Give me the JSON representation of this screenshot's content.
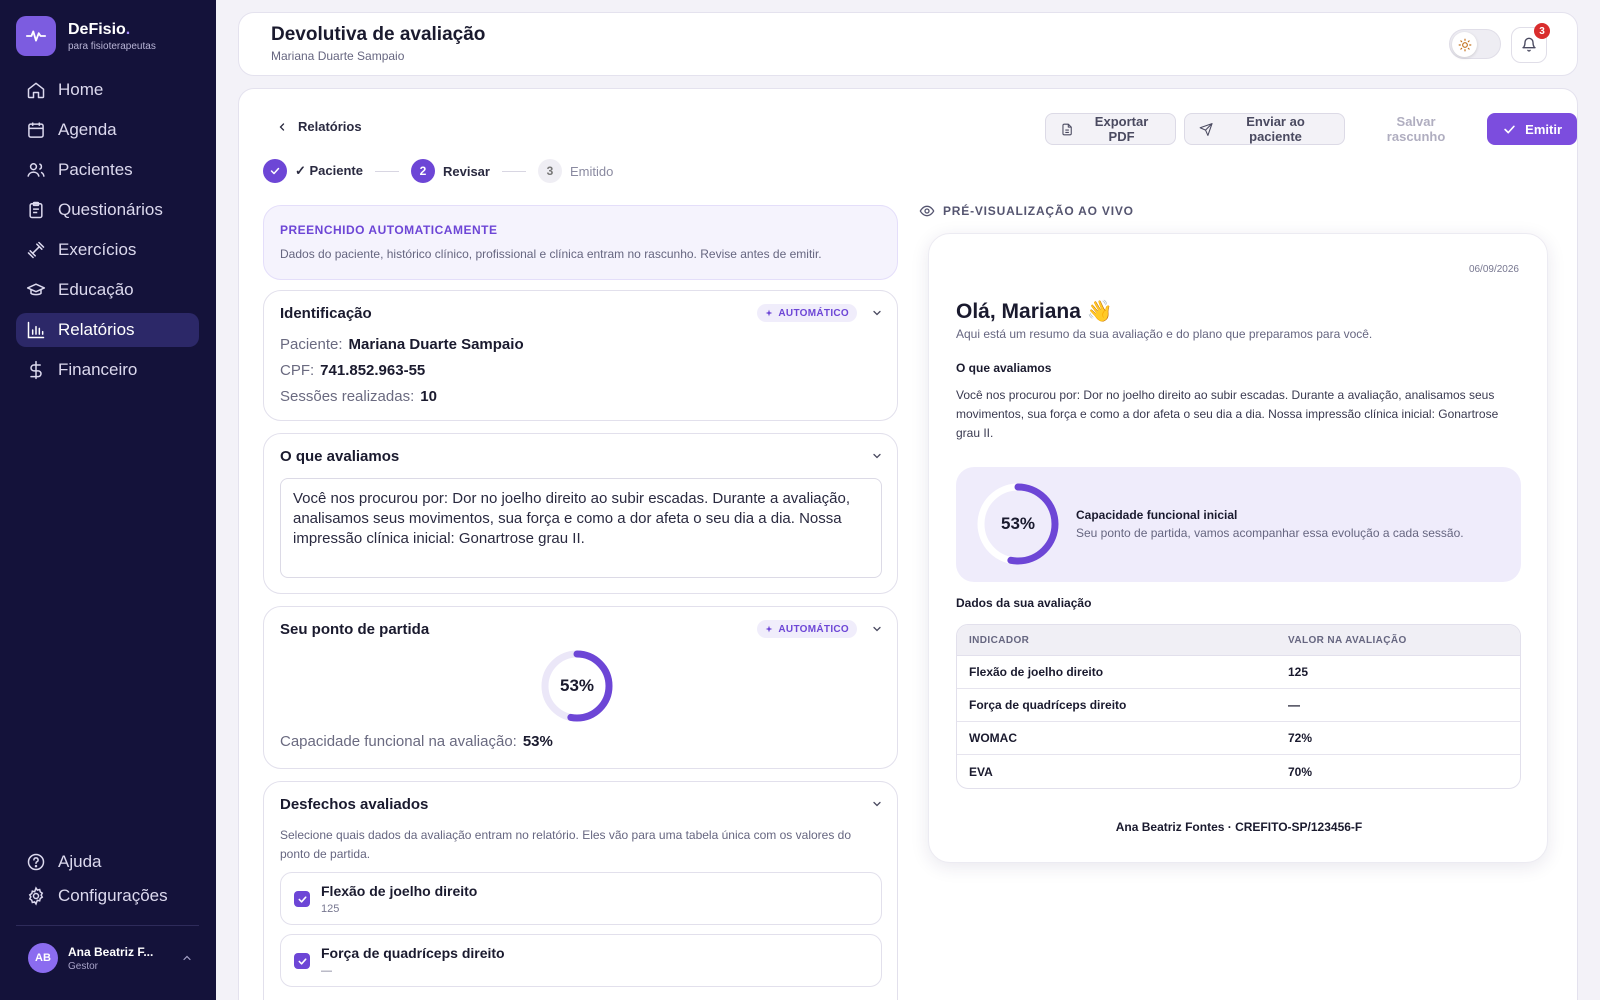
{
  "brand": {
    "name": "DeFisio",
    "dot": ".",
    "tagline": "para fisioterapeutas"
  },
  "nav": [
    {
      "label": "Home",
      "icon": "home-icon",
      "active": false
    },
    {
      "label": "Agenda",
      "icon": "calendar-icon",
      "active": false
    },
    {
      "label": "Pacientes",
      "icon": "users-icon",
      "active": false
    },
    {
      "label": "Questionários",
      "icon": "clipboard-icon",
      "active": false
    },
    {
      "label": "Exercícios",
      "icon": "dumbbell-icon",
      "active": false
    },
    {
      "label": "Educação",
      "icon": "graduation-cap-icon",
      "active": false
    },
    {
      "label": "Relatórios",
      "icon": "bar-chart-icon",
      "active": true
    },
    {
      "label": "Financeiro",
      "icon": "dollar-icon",
      "active": false
    }
  ],
  "nav_bottom": [
    {
      "label": "Ajuda",
      "icon": "help-icon"
    },
    {
      "label": "Configurações",
      "icon": "gear-icon"
    }
  ],
  "user": {
    "initials": "AB",
    "name": "Ana Beatriz F...",
    "role": "Gestor"
  },
  "header": {
    "title": "Devolutiva de avaliação",
    "subtitle": "Mariana Duarte Sampaio",
    "notifications": "3"
  },
  "toolbar": {
    "back_label": "Relatórios",
    "export_label": "Exportar PDF",
    "send_label": "Enviar ao paciente",
    "draft_label": "Salvar rascunho",
    "emit_label": "Emitir"
  },
  "steps": [
    {
      "num": "",
      "label": "✓ Paciente",
      "state": "done"
    },
    {
      "num": "2",
      "label": "Revisar",
      "state": "current"
    },
    {
      "num": "3",
      "label": "Emitido",
      "state": "todo"
    }
  ],
  "auto_fill": {
    "title": "PREENCHIDO AUTOMATICAMENTE",
    "text": "Dados do paciente, histórico clínico, profissional e clínica entram no rascunho. Revise antes de emitir."
  },
  "badge_auto": "AUTOMÁTICO",
  "identification": {
    "title": "Identificação",
    "patient_label": "Paciente:",
    "patient_value": "Mariana Duarte Sampaio",
    "cpf_label": "CPF:",
    "cpf_value": "741.852.963-55",
    "sessions_label": "Sessões realizadas:",
    "sessions_value": "10"
  },
  "evaluated": {
    "title": "O que avaliamos",
    "text": "Você nos procurou por: Dor no joelho direito ao subir escadas. Durante a avaliação, analisamos seus movimentos, sua força e como a dor afeta o seu dia a dia. Nossa impressão clínica inicial: Gonartrose grau II."
  },
  "starting_point": {
    "title": "Seu ponto de partida",
    "percent": 53,
    "percent_label": "53%",
    "caption_label": "Capacidade funcional na avaliação:",
    "caption_value": "53%"
  },
  "outcomes": {
    "title": "Desfechos avaliados",
    "description": "Selecione quais dados da avaliação entram no relatório. Eles vão para uma tabela única com os valores do ponto de partida.",
    "items": [
      {
        "label": "Flexão de joelho direito",
        "value": "125",
        "checked": true
      },
      {
        "label": "Força de quadríceps direito",
        "value": "—",
        "checked": true
      }
    ]
  },
  "preview": {
    "section_label": "PRÉ-VISUALIZAÇÃO AO VIVO",
    "date": "06/09/2026",
    "greeting": "Olá, Mariana 👋",
    "intro": "Aqui está um resumo da sua avaliação e do plano que preparamos para você.",
    "evaluated_title": "O que avaliamos",
    "evaluated_text": "Você nos procurou por: Dor no joelho direito ao subir escadas. Durante a avaliação, analisamos seus movimentos, sua força e como a dor afeta o seu dia a dia. Nossa impressão clínica inicial: Gonartrose grau II.",
    "capacity_percent": 53,
    "capacity_label": "53%",
    "capacity_title": "Capacidade funcional inicial",
    "capacity_desc": "Seu ponto de partida, vamos acompanhar essa evolução a cada sessão.",
    "table_title": "Dados da sua avaliação",
    "table_headers": [
      "INDICADOR",
      "VALOR NA AVALIAÇÃO"
    ],
    "table_rows": [
      [
        "Flexão de joelho direito",
        "125"
      ],
      [
        "Força de quadríceps direito",
        "—"
      ],
      [
        "WOMAC",
        "72%"
      ],
      [
        "EVA",
        "70%"
      ]
    ],
    "signature": "Ana Beatriz Fontes · CREFITO-SP/123456-F"
  },
  "colors": {
    "sidebar": "#14123a",
    "accent": "#6d46d6",
    "active_nav": "#2c2868",
    "badge": "#d92d2d"
  }
}
